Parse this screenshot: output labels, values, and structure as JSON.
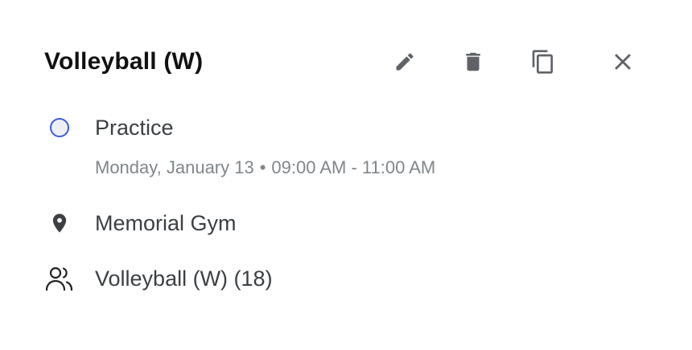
{
  "event": {
    "title": "Volleyball (W)",
    "type": "Practice",
    "date": "Monday, January 13",
    "separator": "•",
    "time": "09:00 AM - 11:00 AM",
    "location": "Memorial Gym",
    "group": "Volleyball (W) (18)"
  },
  "icons": {
    "edit": "pencil-icon",
    "delete": "trash-icon",
    "duplicate": "copy-icon",
    "close": "close-icon",
    "status": "circle-outline-icon",
    "location": "map-pin-icon",
    "group": "people-icon"
  },
  "colors": {
    "title": "#111111",
    "text": "#3c4043",
    "subtext": "#80868b",
    "icon": "#5f6368",
    "status_ring": "#3b5bdb",
    "status_fill": "#eef0f6"
  }
}
